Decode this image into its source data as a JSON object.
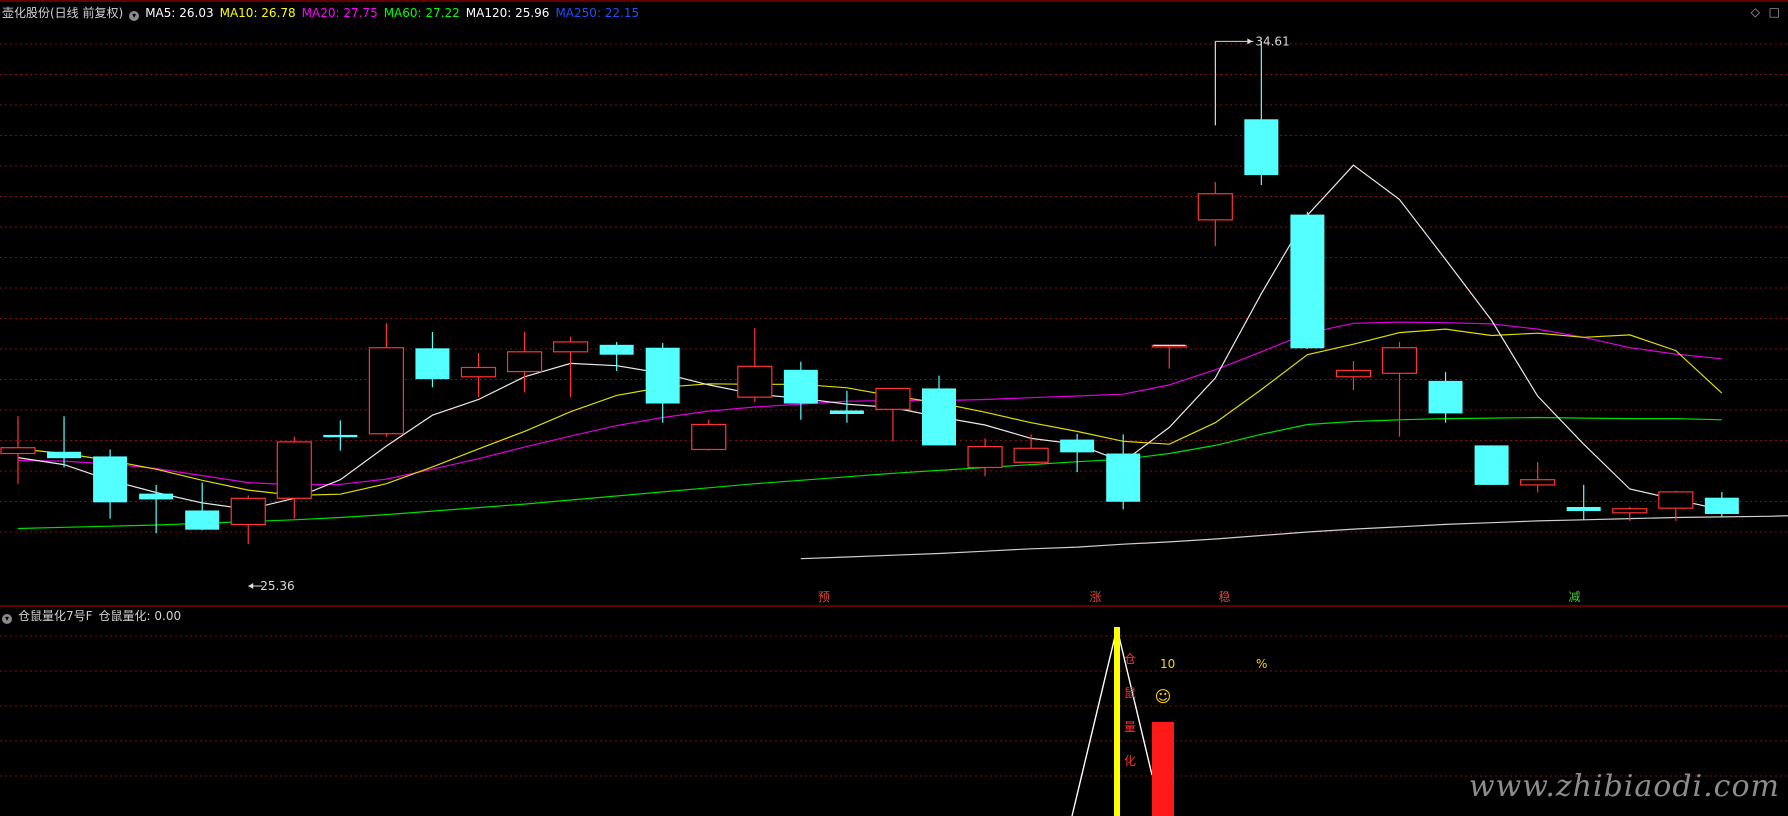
{
  "main_panel": {
    "title": "壶化股份(日线 前复权)",
    "ma_labels": [
      {
        "label": "MA5: 26.03",
        "color": "#ffffff"
      },
      {
        "label": "MA10: 26.78",
        "color": "#ffff00"
      },
      {
        "label": "MA20: 27.75",
        "color": "#ff00ff"
      },
      {
        "label": "MA60: 27.22",
        "color": "#00ff00"
      },
      {
        "label": "MA120: 25.96",
        "color": "#ffffff"
      },
      {
        "label": "MA250: 22.15",
        "color": "#1e50ff"
      }
    ]
  },
  "sub_panel": {
    "title": "仓鼠量化7号F",
    "value_label": "仓鼠量化: 0.00"
  },
  "corner_icons": {
    "diamond": "◇",
    "box": "□"
  },
  "watermark": "www.zhibiaodi.com",
  "colors": {
    "up": "#ff3333",
    "down": "#54ffff",
    "grid": "#801010",
    "axis": "#c00000"
  },
  "chart_data": {
    "type": "candlestick",
    "y_range": [
      25.0,
      35.15
    ],
    "candles": [
      {
        "o": 27.52,
        "c": 27.62,
        "h": 28.16,
        "l": 27.0
      },
      {
        "o": 27.55,
        "c": 27.44,
        "h": 28.16,
        "l": 27.28
      },
      {
        "o": 27.47,
        "c": 26.68,
        "h": 27.59,
        "l": 26.4
      },
      {
        "o": 26.83,
        "c": 26.73,
        "h": 26.98,
        "l": 26.15
      },
      {
        "o": 26.54,
        "c": 26.21,
        "h": 27.02,
        "l": 26.2
      },
      {
        "o": 26.3,
        "c": 26.75,
        "h": 26.8,
        "l": 25.96
      },
      {
        "o": 26.75,
        "c": 27.72,
        "h": 27.81,
        "l": 26.4
      },
      {
        "o": 27.84,
        "c": 27.8,
        "h": 28.09,
        "l": 27.57
      },
      {
        "o": 27.86,
        "c": 29.34,
        "h": 29.76,
        "l": 27.81
      },
      {
        "o": 29.33,
        "c": 28.8,
        "h": 29.61,
        "l": 28.66
      },
      {
        "o": 28.84,
        "c": 29.0,
        "h": 29.25,
        "l": 28.49
      },
      {
        "o": 28.93,
        "c": 29.27,
        "h": 29.61,
        "l": 28.57
      },
      {
        "o": 29.27,
        "c": 29.44,
        "h": 29.53,
        "l": 28.49
      },
      {
        "o": 29.39,
        "c": 29.22,
        "h": 29.44,
        "l": 28.94
      },
      {
        "o": 29.34,
        "c": 28.38,
        "h": 29.42,
        "l": 28.05
      },
      {
        "o": 27.59,
        "c": 28.02,
        "h": 28.1,
        "l": 27.57
      },
      {
        "o": 28.49,
        "c": 29.02,
        "h": 29.68,
        "l": 28.4
      },
      {
        "o": 28.96,
        "c": 28.38,
        "h": 29.1,
        "l": 28.1
      },
      {
        "o": 28.26,
        "c": 28.2,
        "h": 28.6,
        "l": 28.05
      },
      {
        "o": 28.28,
        "c": 28.64,
        "h": 28.64,
        "l": 27.73
      },
      {
        "o": 28.64,
        "c": 27.66,
        "h": 28.86,
        "l": 27.66
      },
      {
        "o": 27.28,
        "c": 27.64,
        "h": 27.78,
        "l": 27.13
      },
      {
        "o": 27.37,
        "c": 27.61,
        "h": 27.85,
        "l": 27.47
      },
      {
        "o": 27.76,
        "c": 27.54,
        "h": 27.86,
        "l": 27.2
      },
      {
        "o": 27.52,
        "c": 26.69,
        "h": 27.85,
        "l": 26.56
      },
      {
        "o": 29.38,
        "c": 29.38,
        "h": 29.38,
        "l": 28.98
      },
      {
        "o": 31.54,
        "c": 31.99,
        "h": 32.19,
        "l": 31.09
      },
      {
        "o": 33.27,
        "c": 32.31,
        "h": 34.61,
        "l": 32.14
      },
      {
        "o": 31.63,
        "c": 29.33,
        "h": 31.68,
        "l": 29.32
      },
      {
        "o": 28.84,
        "c": 28.95,
        "h": 29.11,
        "l": 28.61
      },
      {
        "o": 28.9,
        "c": 29.34,
        "h": 29.44,
        "l": 27.81
      },
      {
        "o": 28.77,
        "c": 28.21,
        "h": 28.92,
        "l": 28.05
      },
      {
        "o": 27.66,
        "c": 26.98,
        "h": 27.66,
        "l": 26.98
      },
      {
        "o": 26.98,
        "c": 27.07,
        "h": 27.37,
        "l": 26.85
      },
      {
        "o": 26.6,
        "c": 26.53,
        "h": 26.98,
        "l": 26.38
      },
      {
        "o": 26.5,
        "c": 26.57,
        "h": 26.6,
        "l": 26.36
      },
      {
        "o": 26.58,
        "c": 26.86,
        "h": 26.88,
        "l": 26.36
      },
      {
        "o": 26.76,
        "c": 26.48,
        "h": 26.86,
        "l": 26.43
      }
    ],
    "ma5": [
      27.45,
      27.33,
      27.06,
      26.85,
      26.67,
      26.56,
      26.75,
      27.07,
      27.65,
      28.18,
      28.45,
      28.84,
      29.07,
      29.03,
      28.9,
      28.7,
      28.54,
      28.47,
      28.37,
      28.31,
      28.15,
      28.01,
      27.78,
      27.68,
      27.38,
      27.97,
      28.82,
      30.27,
      31.62,
      32.48,
      31.89,
      30.86,
      29.81,
      28.51,
      27.68,
      26.91,
      26.73,
      26.55
    ],
    "ma10": [
      27.6,
      27.52,
      27.4,
      27.25,
      27.06,
      26.89,
      26.8,
      26.82,
      27.0,
      27.29,
      27.6,
      27.9,
      28.24,
      28.52,
      28.66,
      28.72,
      28.71,
      28.71,
      28.65,
      28.51,
      28.39,
      28.23,
      28.05,
      27.9,
      27.73,
      27.68,
      28.05,
      28.62,
      29.22,
      29.4,
      29.6,
      29.66,
      29.55,
      29.59,
      29.52,
      29.56,
      29.29,
      28.56
    ],
    "ma20": [
      27.4,
      27.39,
      27.34,
      27.26,
      27.14,
      27.02,
      26.98,
      26.99,
      27.08,
      27.25,
      27.43,
      27.63,
      27.82,
      28.0,
      28.14,
      28.25,
      28.32,
      28.37,
      28.42,
      28.43,
      28.43,
      28.45,
      28.48,
      28.51,
      28.54,
      28.7,
      28.96,
      29.27,
      29.59,
      29.76,
      29.78,
      29.77,
      29.75,
      29.66,
      29.52,
      29.34,
      29.23,
      29.15
    ],
    "ma60": [
      26.23,
      26.25,
      26.27,
      26.29,
      26.32,
      26.35,
      26.38,
      26.42,
      26.47,
      26.53,
      26.59,
      26.65,
      26.72,
      26.79,
      26.86,
      26.93,
      27.0,
      27.06,
      27.12,
      27.18,
      27.23,
      27.28,
      27.33,
      27.38,
      27.42,
      27.52,
      27.66,
      27.85,
      28.02,
      28.07,
      28.1,
      28.12,
      28.13,
      28.14,
      28.13,
      28.12,
      28.12,
      28.1
    ],
    "ma120": [
      25.71,
      25.74,
      25.77,
      25.8,
      25.84,
      25.88,
      25.91,
      25.96,
      26.0,
      26.05,
      26.11,
      26.17,
      26.22,
      26.26,
      26.3,
      26.33,
      26.36,
      26.38,
      26.4,
      26.42,
      26.43,
      26.44,
      26.46
    ],
    "annotations": {
      "high": "34.61",
      "low": "25.36"
    },
    "signals": [
      "预",
      "涨",
      "稳",
      "减"
    ],
    "sub": {
      "number_label": "10",
      "percent_label": "%",
      "emoji": "☺",
      "vertical_text": [
        "仓",
        "鼠",
        "量",
        "化"
      ]
    }
  }
}
